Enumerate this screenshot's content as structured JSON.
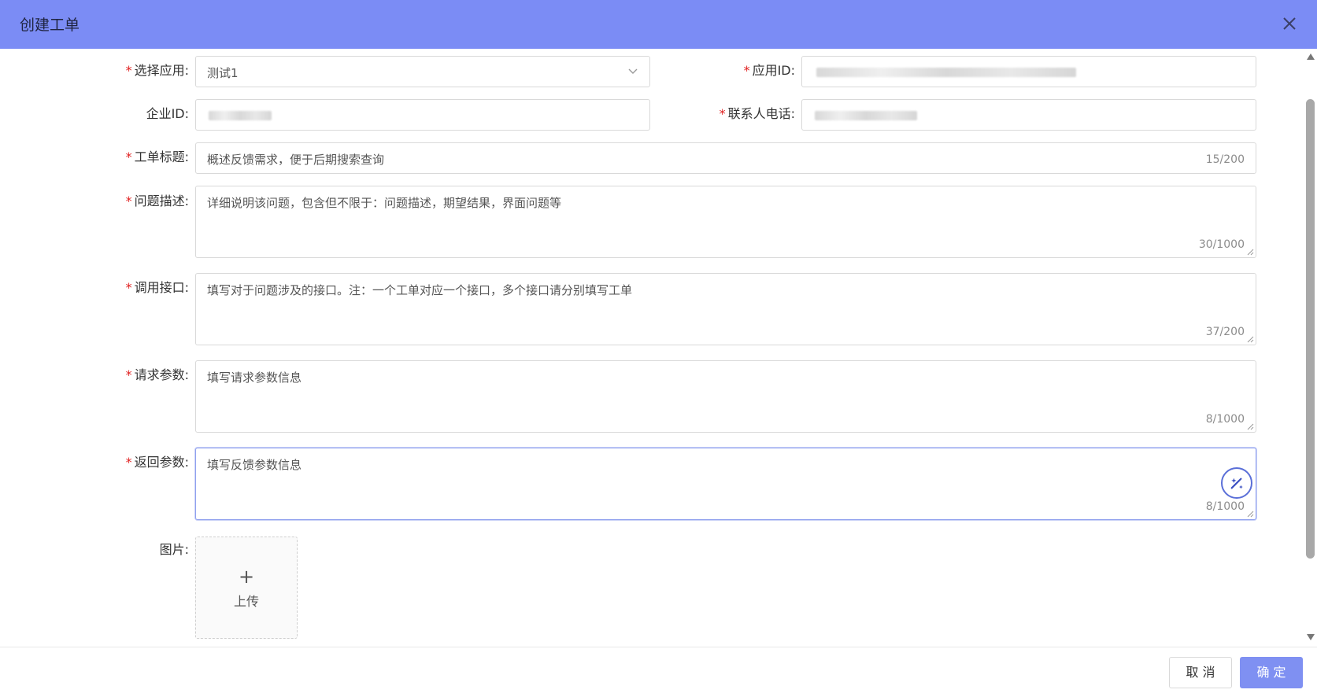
{
  "dialog": {
    "title": "创建工单"
  },
  "form": {
    "app_select": {
      "label": "选择应用:",
      "value": "测试1"
    },
    "app_id": {
      "label": "应用ID:"
    },
    "company_id": {
      "label": "企业ID:"
    },
    "contact_phone": {
      "label": "联系人电话:"
    },
    "ticket_title": {
      "label": "工单标题:",
      "value": "概述反馈需求，便于后期搜索查询",
      "count": "15/200"
    },
    "problem_desc": {
      "label": "问题描述:",
      "value": "详细说明该问题，包含但不限于：问题描述，期望结果，界面问题等",
      "count": "30/1000"
    },
    "api": {
      "label": "调用接口:",
      "value": "填写对于问题涉及的接口。注：一个工单对应一个接口，多个接口请分别填写工单",
      "count": "37/200"
    },
    "request_params": {
      "label": "请求参数:",
      "value": "填写请求参数信息",
      "count": "8/1000"
    },
    "response_params": {
      "label": "返回参数:",
      "value": "填写反馈参数信息",
      "count": "8/1000"
    },
    "image": {
      "label": "图片:",
      "upload_plus": "+",
      "upload_text": "上传"
    }
  },
  "footer": {
    "cancel": "取 消",
    "ok": "确 定"
  },
  "colors": {
    "header": "#7b8cf5",
    "primary": "#7f90f2",
    "required": "#e02020"
  }
}
